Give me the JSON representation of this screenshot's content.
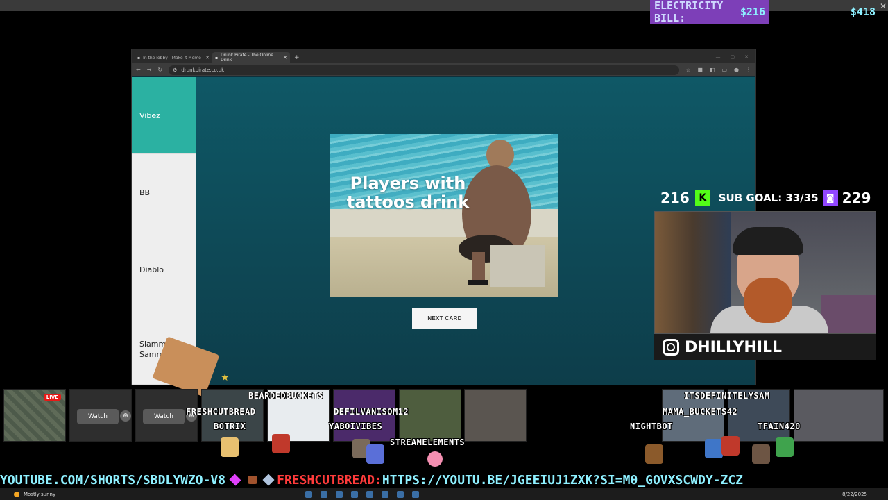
{
  "overlay": {
    "electricity_label": "ELECTRICITY BILL:",
    "electricity_amount": "$216",
    "money_right": "$418",
    "kick_count": "216",
    "sub_goal": "SUB GOAL: 33/35",
    "twitch_count": "229",
    "instagram_handle": "DHILLYHILL"
  },
  "browser": {
    "tabs": [
      {
        "title": "In the lobby - Make it Meme",
        "active": false
      },
      {
        "title": "Drunk Pirate - The Online Drink",
        "active": true
      }
    ],
    "url": "drunkpirate.co.uk"
  },
  "page": {
    "sidebar": [
      {
        "label": "Vibez",
        "active": true
      },
      {
        "label": "BB",
        "active": false
      },
      {
        "label": "Diablo",
        "active": false
      },
      {
        "label": "Slammy Sammy",
        "active": false
      }
    ],
    "card_text": "Players with tattoos drink",
    "next_button": "NEXT CARD"
  },
  "stream_thumbs": {
    "live_badge": "LIVE",
    "watch_label": "Watch"
  },
  "chat_names": {
    "n1": "BEARDEDBUCKETS",
    "n2": "FRESHCUTBREAD",
    "n3": "BOTRIX",
    "n4": "DEFILVANISOM12",
    "n5": "YABOIVIBES",
    "n6": "STREAMELEMENTS",
    "n7": "ITSDEFINITELYSAM",
    "n8": "MAMA_BUCKETS42",
    "n9": "NIGHTBOT",
    "n10": "TFAIN420"
  },
  "ticker": {
    "part1": "YOUTUBE.COM/SHORTS/SBDLYWZO-V8",
    "user": "FRESHCUTBREAD:",
    "part2": "HTTPS://YOUTU.BE/JGEEIUJ1ZXK?SI=M0_GOVXSCWDY-ZCZ"
  },
  "taskbar": {
    "weather": "Mostly sunny",
    "date": "8/22/2025"
  },
  "colors": {
    "sidebar_active": "#2bb1a2",
    "page_bg": "#0f5866",
    "ticker_text": "#8ef0ff",
    "electricity_bg": "#7d3fb8"
  }
}
